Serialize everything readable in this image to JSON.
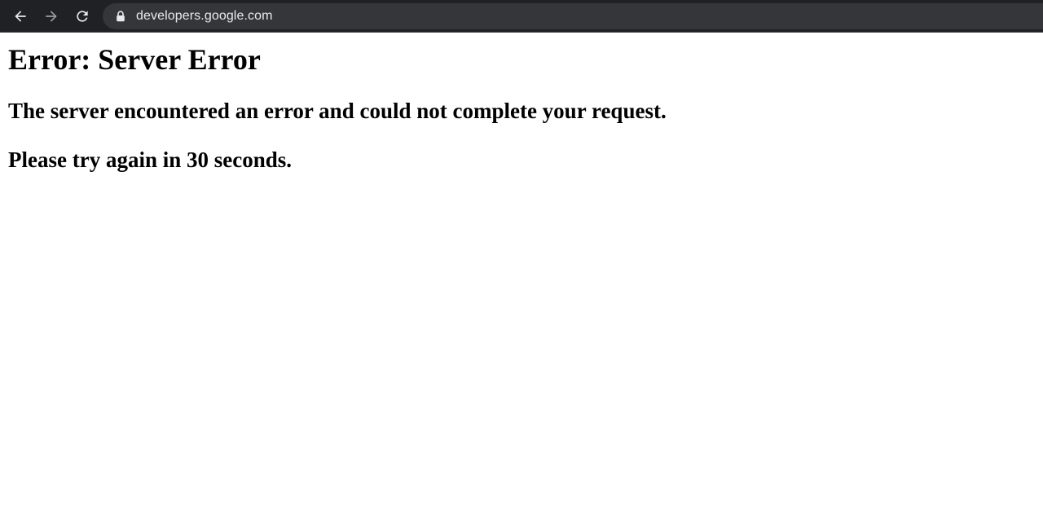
{
  "browser": {
    "url": "developers.google.com",
    "icons": {
      "back": "back-arrow-icon",
      "forward": "forward-arrow-icon",
      "reload": "reload-icon",
      "lock": "lock-icon"
    },
    "colors": {
      "toolbar": "#202124",
      "omnibox": "#35363a",
      "icon_active": "#e8eaed",
      "icon_disabled": "#9aa0a6"
    }
  },
  "page": {
    "title": "Error: Server Error",
    "message": "The server encountered an error and could not complete your request.",
    "retry": "Please try again in 30 seconds."
  }
}
